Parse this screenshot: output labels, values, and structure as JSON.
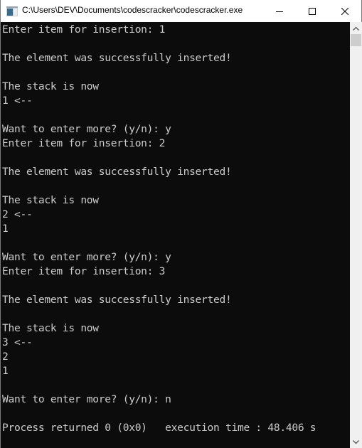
{
  "window": {
    "title": "C:\\Users\\DEV\\Documents\\codescracker\\codescracker.exe",
    "controls": {
      "minimize": "minimize",
      "maximize": "maximize",
      "close": "close"
    }
  },
  "console": {
    "lines": [
      "Enter item for insertion: 1",
      "",
      "The element was successfully inserted!",
      "",
      "The stack is now",
      "1 <--",
      "",
      "Want to enter more? (y/n): y",
      "Enter item for insertion: 2",
      "",
      "The element was successfully inserted!",
      "",
      "The stack is now",
      "2 <--",
      "1",
      "",
      "Want to enter more? (y/n): y",
      "Enter item for insertion: 3",
      "",
      "The element was successfully inserted!",
      "",
      "The stack is now",
      "3 <--",
      "2",
      "1",
      "",
      "Want to enter more? (y/n): n",
      "",
      "Process returned 0 (0x0)   execution time : 48.406 s"
    ]
  },
  "colors": {
    "console_bg": "#0c0c0c",
    "console_fg": "#cccccc",
    "titlebar_bg": "#ffffff",
    "scrollbar_bg": "#f0f0f0",
    "scrollbar_thumb": "#cdcdcd"
  }
}
